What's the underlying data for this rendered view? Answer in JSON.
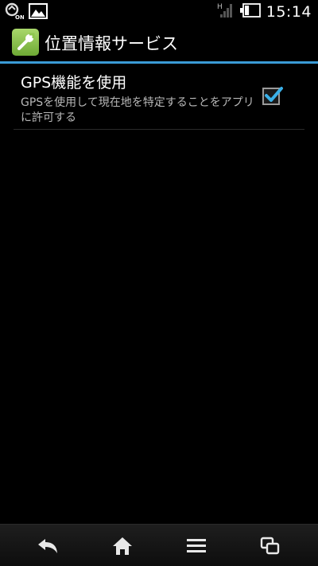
{
  "status_bar": {
    "time": "15:14",
    "left_icons": [
      "location-on-icon",
      "image-icon"
    ],
    "signal_label": "H",
    "battery_level": 0.3
  },
  "action_bar": {
    "title": "位置情報サービス",
    "app_icon": "wrench-icon",
    "accent_color": "#3a9bd6"
  },
  "preference": {
    "title": "GPS機能を使用",
    "summary": "GPSを使用して現在地を特定することをアプリに許可する",
    "checked": true,
    "check_color": "#3ab0e8"
  },
  "nav_bar": {
    "buttons": [
      "back-icon",
      "home-icon",
      "menu-icon",
      "recent-apps-icon"
    ]
  }
}
